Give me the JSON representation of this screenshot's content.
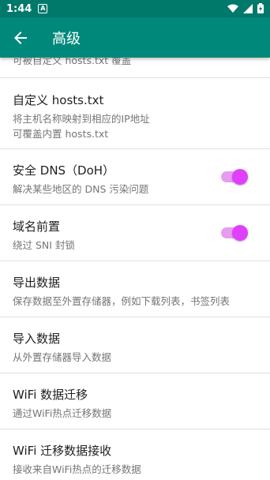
{
  "status_bar": {
    "time": "1:44",
    "notification_glyph": "A"
  },
  "app_bar": {
    "title": "高级"
  },
  "items": [
    {
      "title": "",
      "summary": "可被自定义 hosts.txt 覆盖"
    },
    {
      "title": "自定义 hosts.txt",
      "summary": "将主机名称映射到相应的IP地址",
      "summary2": "可覆盖内置 hosts.txt"
    },
    {
      "title": "安全 DNS（DoH）",
      "summary": "解决某些地区的 DNS 污染问题",
      "switch_on": true
    },
    {
      "title": "域名前置",
      "summary": "绕过 SNI 封锁",
      "switch_on": true
    },
    {
      "title": "导出数据",
      "summary": "保存数据至外置存储器，例如下载列表，书签列表"
    },
    {
      "title": "导入数据",
      "summary": "从外置存储器导入数据"
    },
    {
      "title": "WiFi 数据迁移",
      "summary": "通过WiFi热点迁移数据"
    },
    {
      "title": "WiFi 迁移数据接收",
      "summary": "接收来自WiFi热点的迁移数据"
    }
  ],
  "colors": {
    "primary": "#00897b",
    "primary_dark": "#00796b",
    "accent": "#e040fb"
  }
}
